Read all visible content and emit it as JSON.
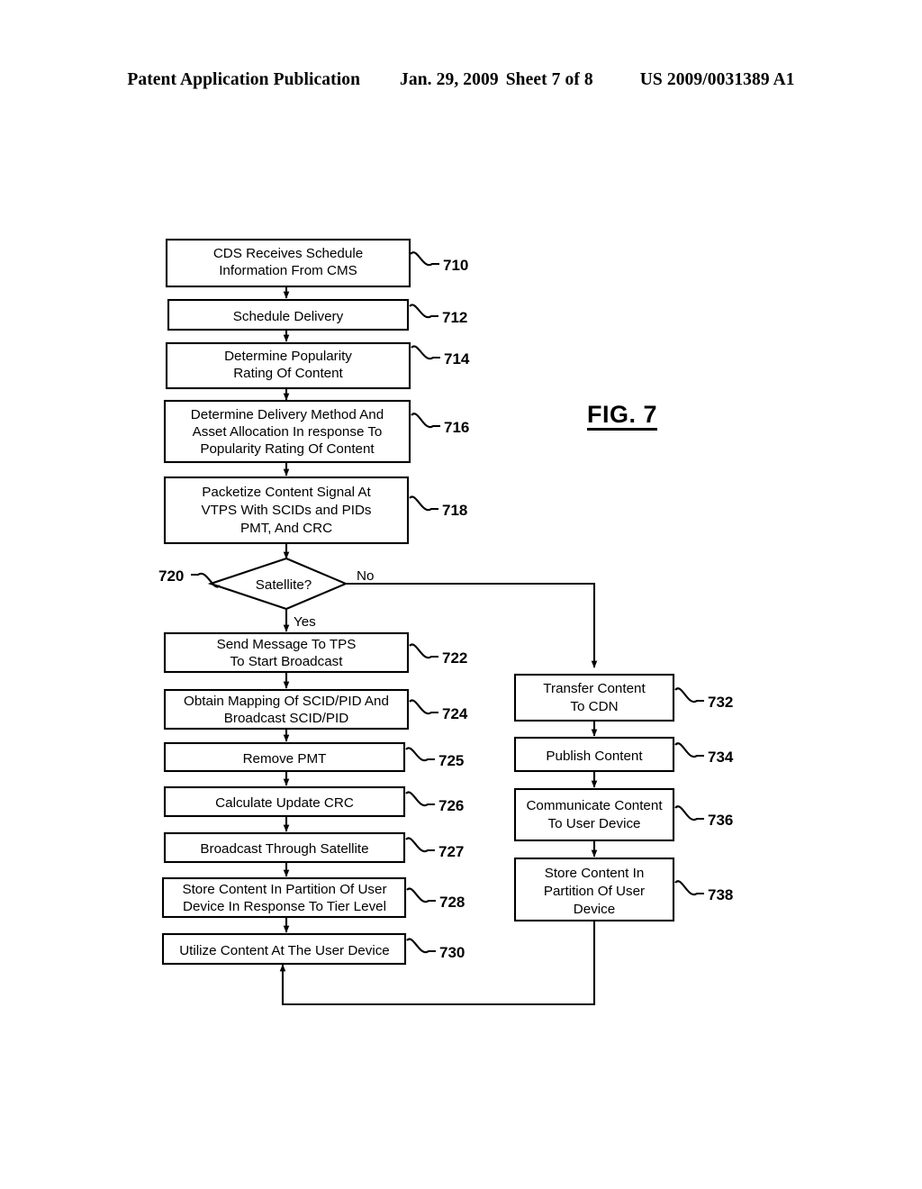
{
  "header": {
    "publication": "Patent Application Publication",
    "date": "Jan. 29, 2009",
    "sheet": "Sheet 7 of 8",
    "number": "US 2009/0031389 A1"
  },
  "figure": {
    "label": "FIG. 7"
  },
  "flowchart": {
    "branch_labels": {
      "no": "No",
      "yes": "Yes"
    },
    "decision": {
      "id": "720",
      "text": "Satellite?",
      "ref": "720"
    },
    "nodes": [
      {
        "id": "710",
        "ref": "710",
        "lines": [
          "CDS Receives Schedule",
          "Information From CMS"
        ]
      },
      {
        "id": "712",
        "ref": "712",
        "lines": [
          "Schedule Delivery"
        ]
      },
      {
        "id": "714",
        "ref": "714",
        "lines": [
          "Determine Popularity",
          "Rating Of Content"
        ]
      },
      {
        "id": "716",
        "ref": "716",
        "lines": [
          "Determine Delivery Method And",
          "Asset Allocation In response To",
          "Popularity Rating Of Content"
        ]
      },
      {
        "id": "718",
        "ref": "718",
        "lines": [
          "Packetize Content Signal At",
          "VTPS With SCIDs and PIDs",
          "PMT, And CRC"
        ]
      },
      {
        "id": "722",
        "ref": "722",
        "lines": [
          "Send Message To TPS",
          "To Start Broadcast"
        ]
      },
      {
        "id": "724",
        "ref": "724",
        "lines": [
          "Obtain Mapping Of SCID/PID And",
          "Broadcast SCID/PID"
        ]
      },
      {
        "id": "725",
        "ref": "725",
        "lines": [
          "Remove PMT"
        ]
      },
      {
        "id": "726",
        "ref": "726",
        "lines": [
          "Calculate Update CRC"
        ]
      },
      {
        "id": "727",
        "ref": "727",
        "lines": [
          "Broadcast Through Satellite"
        ]
      },
      {
        "id": "728",
        "ref": "728",
        "lines": [
          "Store Content In Partition Of User",
          "Device In Response To Tier Level"
        ]
      },
      {
        "id": "730",
        "ref": "730",
        "lines": [
          "Utilize Content At The User Device"
        ]
      },
      {
        "id": "732",
        "ref": "732",
        "lines": [
          "Transfer Content",
          "To CDN"
        ]
      },
      {
        "id": "734",
        "ref": "734",
        "lines": [
          "Publish Content"
        ]
      },
      {
        "id": "736",
        "ref": "736",
        "lines": [
          "Communicate Content",
          "To User Device"
        ]
      },
      {
        "id": "738",
        "ref": "738",
        "lines": [
          "Store Content In",
          "Partition Of User",
          "Device"
        ]
      }
    ]
  }
}
